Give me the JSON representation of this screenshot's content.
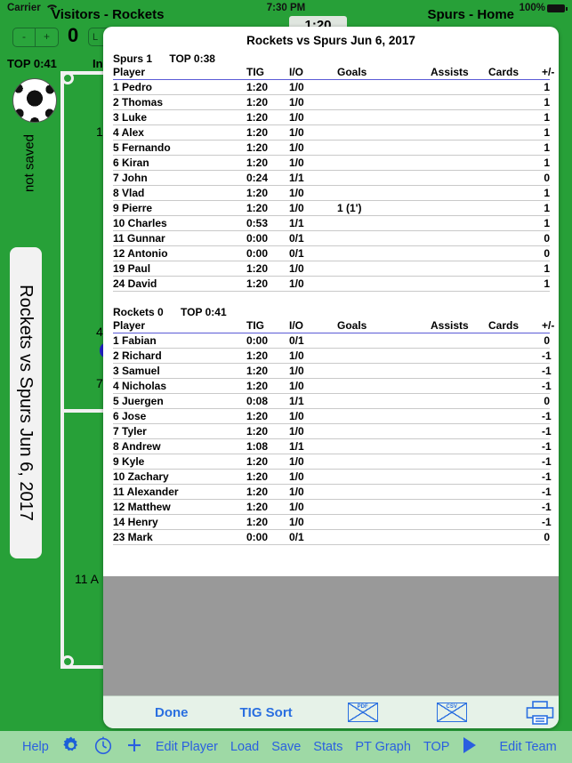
{
  "status_bar": {
    "carrier": "Carrier",
    "wifi_icon": "wifi-icon",
    "time": "7:30 PM",
    "battery_percent": "100%",
    "battery_icon": "battery-full-icon"
  },
  "app": {
    "visitors_team_label": "Visitors - Rockets",
    "home_team_label": "Spurs  - Home",
    "visitor_score": "0",
    "stepper_minus": "-",
    "stepper_plus": "+",
    "left_button_label": "L",
    "top_timer_label": "TOP 0:41",
    "in_label": "In",
    "ball_icon": "soccer-ball-icon",
    "not_saved_label": "not saved",
    "game_title_vertical": "Rockets vs Spurs Jun 6, 2017",
    "center_timer": "1:20",
    "field_numbers": [
      "1",
      "4",
      "7",
      "11 A"
    ]
  },
  "bottom_toolbar": {
    "items": [
      {
        "label": "Help",
        "icon": ""
      },
      {
        "label": "",
        "icon": "gear-icon"
      },
      {
        "label": "",
        "icon": "clock-icon"
      },
      {
        "label": "",
        "icon": "plus-icon"
      },
      {
        "label": "Edit Player",
        "icon": ""
      },
      {
        "label": "Load",
        "icon": ""
      },
      {
        "label": "Save",
        "icon": ""
      },
      {
        "label": "Stats",
        "icon": ""
      },
      {
        "label": "PT Graph",
        "icon": ""
      },
      {
        "label": "TOP",
        "icon": ""
      },
      {
        "label": "",
        "icon": "play-icon"
      },
      {
        "label": "Edit Team",
        "icon": ""
      }
    ]
  },
  "modal": {
    "title": "Rockets vs Spurs Jun 6, 2017",
    "columns": [
      "Player",
      "TIG",
      "I/O",
      "Goals",
      "Assists",
      "Cards",
      "+/-"
    ],
    "teams": [
      {
        "name": "Spurs",
        "score": "1",
        "top": "TOP 0:38",
        "header_line": "Spurs 1",
        "top_line": "TOP 0:38",
        "rows": [
          {
            "player": "1 Pedro",
            "tig": "1:20",
            "io": "1/0",
            "goals": "",
            "assists": "",
            "cards": "",
            "pm": "1"
          },
          {
            "player": "2 Thomas",
            "tig": "1:20",
            "io": "1/0",
            "goals": "",
            "assists": "",
            "cards": "",
            "pm": "1"
          },
          {
            "player": "3 Luke",
            "tig": "1:20",
            "io": "1/0",
            "goals": "",
            "assists": "",
            "cards": "",
            "pm": "1"
          },
          {
            "player": "4 Alex",
            "tig": "1:20",
            "io": "1/0",
            "goals": "",
            "assists": "",
            "cards": "",
            "pm": "1"
          },
          {
            "player": "5 Fernando",
            "tig": "1:20",
            "io": "1/0",
            "goals": "",
            "assists": "",
            "cards": "",
            "pm": "1"
          },
          {
            "player": "6 Kiran",
            "tig": "1:20",
            "io": "1/0",
            "goals": "",
            "assists": "",
            "cards": "",
            "pm": "1"
          },
          {
            "player": "7 John",
            "tig": "0:24",
            "io": "1/1",
            "goals": "",
            "assists": "",
            "cards": "",
            "pm": "0"
          },
          {
            "player": "8 Vlad",
            "tig": "1:20",
            "io": "1/0",
            "goals": "",
            "assists": "",
            "cards": "",
            "pm": "1"
          },
          {
            "player": "9 Pierre",
            "tig": "1:20",
            "io": "1/0",
            "goals": "1 (1')",
            "assists": "",
            "cards": "",
            "pm": "1"
          },
          {
            "player": "10 Charles",
            "tig": "0:53",
            "io": "1/1",
            "goals": "",
            "assists": "",
            "cards": "",
            "pm": "1"
          },
          {
            "player": "11 Gunnar",
            "tig": "0:00",
            "io": "0/1",
            "goals": "",
            "assists": "",
            "cards": "",
            "pm": "0"
          },
          {
            "player": "12 Antonio",
            "tig": "0:00",
            "io": "0/1",
            "goals": "",
            "assists": "",
            "cards": "",
            "pm": "0"
          },
          {
            "player": "19 Paul",
            "tig": "1:20",
            "io": "1/0",
            "goals": "",
            "assists": "",
            "cards": "",
            "pm": "1"
          },
          {
            "player": "24 David",
            "tig": "1:20",
            "io": "1/0",
            "goals": "",
            "assists": "",
            "cards": "",
            "pm": "1"
          }
        ]
      },
      {
        "name": "Rockets",
        "score": "0",
        "top": "TOP 0:41",
        "header_line": "Rockets 0",
        "top_line": "TOP 0:41",
        "rows": [
          {
            "player": "1 Fabian",
            "tig": "0:00",
            "io": "0/1",
            "goals": "",
            "assists": "",
            "cards": "",
            "pm": "0"
          },
          {
            "player": "2 Richard",
            "tig": "1:20",
            "io": "1/0",
            "goals": "",
            "assists": "",
            "cards": "",
            "pm": "-1"
          },
          {
            "player": "3 Samuel",
            "tig": "1:20",
            "io": "1/0",
            "goals": "",
            "assists": "",
            "cards": "",
            "pm": "-1"
          },
          {
            "player": "4 Nicholas",
            "tig": "1:20",
            "io": "1/0",
            "goals": "",
            "assists": "",
            "cards": "",
            "pm": "-1"
          },
          {
            "player": "5 Juergen",
            "tig": "0:08",
            "io": "1/1",
            "goals": "",
            "assists": "",
            "cards": "",
            "pm": "0"
          },
          {
            "player": "6 Jose",
            "tig": "1:20",
            "io": "1/0",
            "goals": "",
            "assists": "",
            "cards": "",
            "pm": "-1"
          },
          {
            "player": "7 Tyler",
            "tig": "1:20",
            "io": "1/0",
            "goals": "",
            "assists": "",
            "cards": "",
            "pm": "-1"
          },
          {
            "player": "8 Andrew",
            "tig": "1:08",
            "io": "1/1",
            "goals": "",
            "assists": "",
            "cards": "",
            "pm": "-1"
          },
          {
            "player": "9 Kyle",
            "tig": "1:20",
            "io": "1/0",
            "goals": "",
            "assists": "",
            "cards": "",
            "pm": "-1"
          },
          {
            "player": "10 Zachary",
            "tig": "1:20",
            "io": "1/0",
            "goals": "",
            "assists": "",
            "cards": "",
            "pm": "-1"
          },
          {
            "player": "11 Alexander",
            "tig": "1:20",
            "io": "1/0",
            "goals": "",
            "assists": "",
            "cards": "",
            "pm": "-1"
          },
          {
            "player": "12 Matthew",
            "tig": "1:20",
            "io": "1/0",
            "goals": "",
            "assists": "",
            "cards": "",
            "pm": "-1"
          },
          {
            "player": "14 Henry",
            "tig": "1:20",
            "io": "1/0",
            "goals": "",
            "assists": "",
            "cards": "",
            "pm": "-1"
          },
          {
            "player": "23 Mark",
            "tig": "0:00",
            "io": "0/1",
            "goals": "",
            "assists": "",
            "cards": "",
            "pm": "0"
          }
        ]
      }
    ],
    "toolbar": {
      "done_label": "Done",
      "sort_label": "TIG Sort",
      "pdf_label": "PDF",
      "csv_label": "CSV",
      "print_icon": "printer-icon"
    }
  },
  "colors": {
    "field_green": "#27a038",
    "toolbar_green": "#9ed9a5",
    "link_blue": "#2a6fe0",
    "header_rule": "#5b5bd6",
    "gray_pad": "#999999"
  }
}
